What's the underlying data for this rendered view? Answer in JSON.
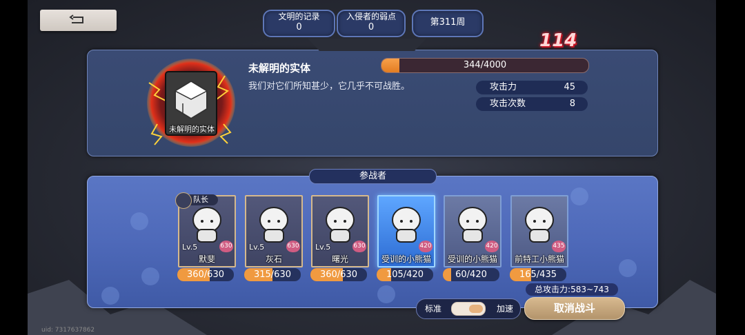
{
  "header": {
    "civilization_records": {
      "label": "文明的记录",
      "value": "0"
    },
    "invader_weakness": {
      "label": "入侵者的弱点",
      "value": "0"
    },
    "week": "第311周"
  },
  "boss": {
    "name": "未解明的实体",
    "emblem_label": "未解明的实体",
    "description": "我们对它们所知甚少，它几乎不可战胜。",
    "hp": {
      "current": 344,
      "max": 4000,
      "text": "344/4000"
    },
    "damage_popup": "114",
    "stats": [
      {
        "label": "攻击力",
        "value": "45"
      },
      {
        "label": "攻击次数",
        "value": "8"
      }
    ]
  },
  "participants": {
    "title": "参战者",
    "captain_label": "队长",
    "members": [
      {
        "name": "默斐",
        "level": "Lv.5",
        "power": "630",
        "hp_text": "360/630",
        "hp": 360,
        "hp_max": 630,
        "style": "normal"
      },
      {
        "name": "灰石",
        "level": "Lv.5",
        "power": "630",
        "hp_text": "315/630",
        "hp": 315,
        "hp_max": 630,
        "style": "normal"
      },
      {
        "name": "曙光",
        "level": "Lv.5",
        "power": "630",
        "hp_text": "360/630",
        "hp": 360,
        "hp_max": 630,
        "style": "normal"
      },
      {
        "name": "受训的小熊猫",
        "level": "",
        "power": "420",
        "hp_text": "105/420",
        "hp": 105,
        "hp_max": 420,
        "style": "selected"
      },
      {
        "name": "受训的小熊猫",
        "level": "",
        "power": "420",
        "hp_text": "60/420",
        "hp": 60,
        "hp_max": 420,
        "style": "rare"
      },
      {
        "name": "前特工小熊猫",
        "level": "",
        "power": "435",
        "hp_text": "165/435",
        "hp": 165,
        "hp_max": 435,
        "style": "rare"
      }
    ],
    "total_attack": "总攻击力:583~743"
  },
  "controls": {
    "speed_normal": "标准",
    "speed_fast": "加速",
    "speed_toggle_on": true,
    "cancel_battle": "取消战斗"
  },
  "footer": {
    "uid": "uid: 7317637862"
  },
  "colors": {
    "hp_fill": "#f09a40",
    "panel_blue": "#4e69b9",
    "damage_red": "#e0202f"
  }
}
